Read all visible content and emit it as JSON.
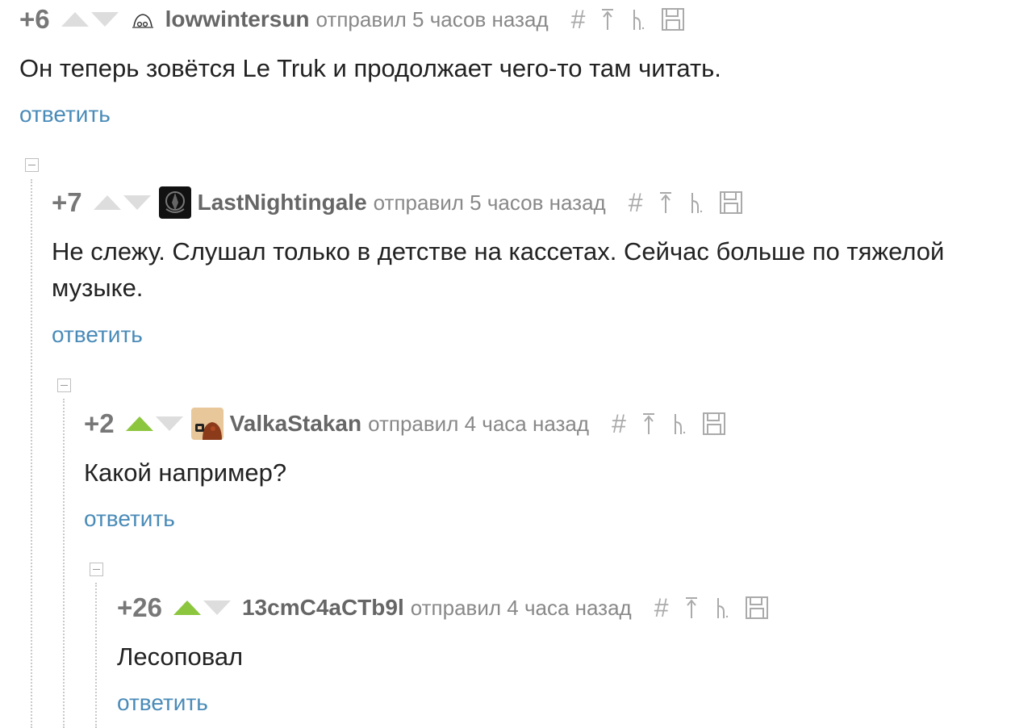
{
  "comments": [
    {
      "rating": "+6",
      "vote_state": "none",
      "author": "lowwintersun",
      "meta": "отправил 5 часов назад",
      "text": "Он теперь зовётся Le Truk и продолжает чего-то там читать.",
      "reply_label": "ответить",
      "avatar_icon": "face-doodle-icon"
    },
    {
      "rating": "+7",
      "vote_state": "none",
      "author": "LastNightingale",
      "meta": "отправил 5 часов назад",
      "text": "Не слежу. Слушал только в детстве на кассетах. Сейчас больше по тяжелой музыке.",
      "reply_label": "ответить",
      "avatar_icon": "dark-emblem-icon"
    },
    {
      "rating": "+2",
      "vote_state": "up",
      "author": "ValkaStakan",
      "meta": "отправил 4 часа назад",
      "text": "Какой например?",
      "reply_label": "ответить",
      "avatar_icon": "cartoon-avatar-icon"
    },
    {
      "rating": "+26",
      "vote_state": "up",
      "author": "13cmC4aCTb9l",
      "meta": "отправил 4 часа назад",
      "text": "Лесоповал",
      "reply_label": "ответить",
      "avatar_icon": "none"
    }
  ],
  "tools": {
    "hash": "#",
    "icons": [
      "link-icon",
      "parent-comment-icon",
      "branch-icon",
      "save-icon"
    ]
  },
  "colors": {
    "vote_active": "#8cc63f",
    "vote_inactive": "#dddddd",
    "reply": "#4a8bb8",
    "author": "#666666",
    "meta": "#888888"
  }
}
